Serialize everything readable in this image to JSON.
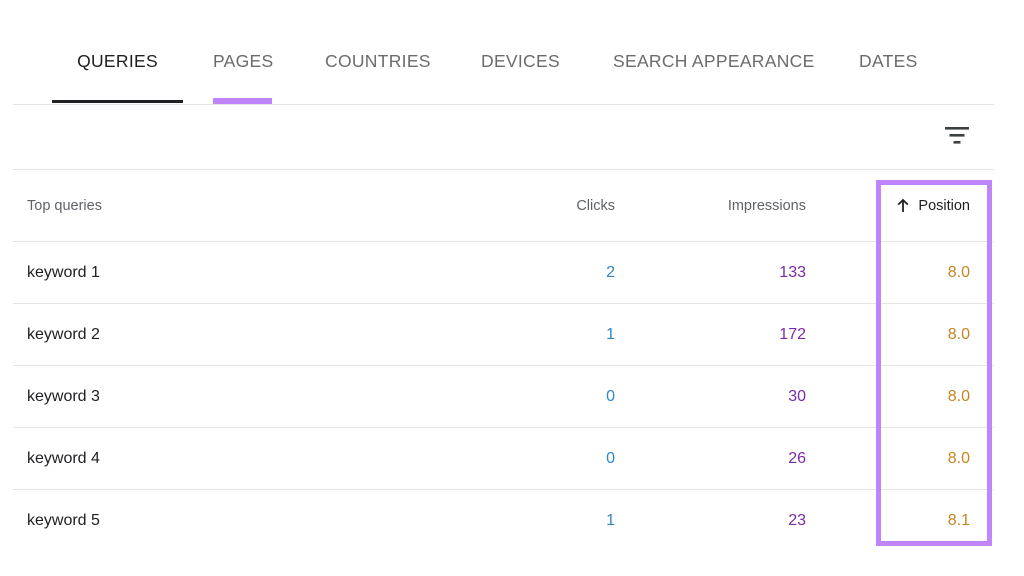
{
  "tabs": [
    {
      "label": "QUERIES"
    },
    {
      "label": "PAGES"
    },
    {
      "label": "COUNTRIES"
    },
    {
      "label": "DEVICES"
    },
    {
      "label": "SEARCH APPEARANCE"
    },
    {
      "label": "DATES"
    }
  ],
  "active_tab": "QUERIES",
  "icons": {
    "filter": "filter-icon",
    "sort": "arrow-up-icon"
  },
  "table": {
    "headers": {
      "query": "Top queries",
      "clicks": "Clicks",
      "impressions": "Impressions",
      "position": "Position"
    },
    "sorted_by": "Position",
    "sort_direction": "ascending",
    "rows": [
      {
        "query": "keyword 1",
        "clicks": "2",
        "impressions": "133",
        "position": "8.0"
      },
      {
        "query": "keyword 2",
        "clicks": "1",
        "impressions": "172",
        "position": "8.0"
      },
      {
        "query": "keyword 3",
        "clicks": "0",
        "impressions": "30",
        "position": "8.0"
      },
      {
        "query": "keyword 4",
        "clicks": "0",
        "impressions": "26",
        "position": "8.0"
      },
      {
        "query": "keyword 5",
        "clicks": "1",
        "impressions": "23",
        "position": "8.1"
      }
    ]
  },
  "colors": {
    "highlight": "#c084fc",
    "clicks": "#2f86c9",
    "impressions": "#7b2aa6",
    "position": "#c7851e",
    "active_tab_underline": "#202124"
  }
}
